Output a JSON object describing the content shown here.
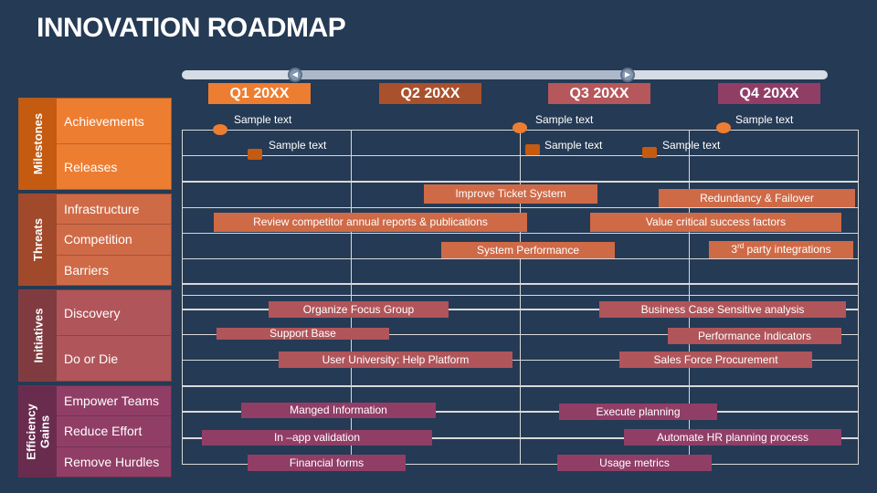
{
  "title": "INNOVATION ROADMAP",
  "colors": {
    "background": "#253A54",
    "milestones_tab": "#C55A11",
    "milestones_row": "#ED7D31",
    "threats_tab": "#A0492B",
    "threats_row": "#CF6A47",
    "initiatives_tab": "#7F3B3F",
    "initiatives_row": "#B0555A",
    "efficiency_tab": "#6A2C4E",
    "efficiency_row": "#913E67",
    "q1": "#ED7D31",
    "q2": "#A9502D",
    "q3": "#B5575B",
    "q4": "#913E67"
  },
  "timeline": {
    "slider": {
      "start_icon": "chevron-left-icon",
      "end_icon": "play-icon"
    },
    "quarters": [
      {
        "label": "Q1 20XX"
      },
      {
        "label": "Q2 20XX"
      },
      {
        "label": "Q3 20XX"
      },
      {
        "label": "Q4 20XX"
      }
    ]
  },
  "sections": [
    {
      "name": "Milestones",
      "rows": [
        "Achievements",
        "Releases"
      ]
    },
    {
      "name": "Threats",
      "rows": [
        "Infrastructure",
        "Competition",
        "Barriers"
      ]
    },
    {
      "name": "Initiatives",
      "rows": [
        "Discovery",
        "Do or Die"
      ]
    },
    {
      "name": "Efficiency Gains",
      "rows": [
        "Empower Teams",
        "Reduce Effort",
        "Remove Hurdles"
      ]
    }
  ],
  "milestones": {
    "achievements": [
      {
        "text": "Sample text",
        "marker": "circle"
      },
      {
        "text": "Sample text",
        "marker": "circle"
      },
      {
        "text": "Sample text",
        "marker": "circle"
      }
    ],
    "releases": [
      {
        "text": "Sample text",
        "marker": "square"
      },
      {
        "text": "Sample text",
        "marker": "square"
      },
      {
        "text": "Sample text",
        "marker": "square"
      }
    ]
  },
  "threats": [
    {
      "label": "Improve Ticket System"
    },
    {
      "label": "Redundancy & Failover"
    },
    {
      "label": "Review competitor annual reports & publications"
    },
    {
      "label": "Value critical success factors"
    },
    {
      "label": "System Performance"
    },
    {
      "label": "party integrations",
      "prefix": "3",
      "sup": "rd"
    }
  ],
  "initiatives": [
    {
      "label": "Organize Focus Group"
    },
    {
      "label": "Business Case Sensitive  analysis"
    },
    {
      "label": "Support Base"
    },
    {
      "label": "Performance Indicators"
    },
    {
      "label": "User University: Help Platform"
    },
    {
      "label": "Sales Force Procurement"
    }
  ],
  "efficiency": [
    {
      "label": "Manged Information"
    },
    {
      "label": "Execute planning"
    },
    {
      "label": "In –app validation"
    },
    {
      "label": "Automate HR planning process"
    },
    {
      "label": "Financial forms"
    },
    {
      "label": "Usage metrics"
    }
  ]
}
